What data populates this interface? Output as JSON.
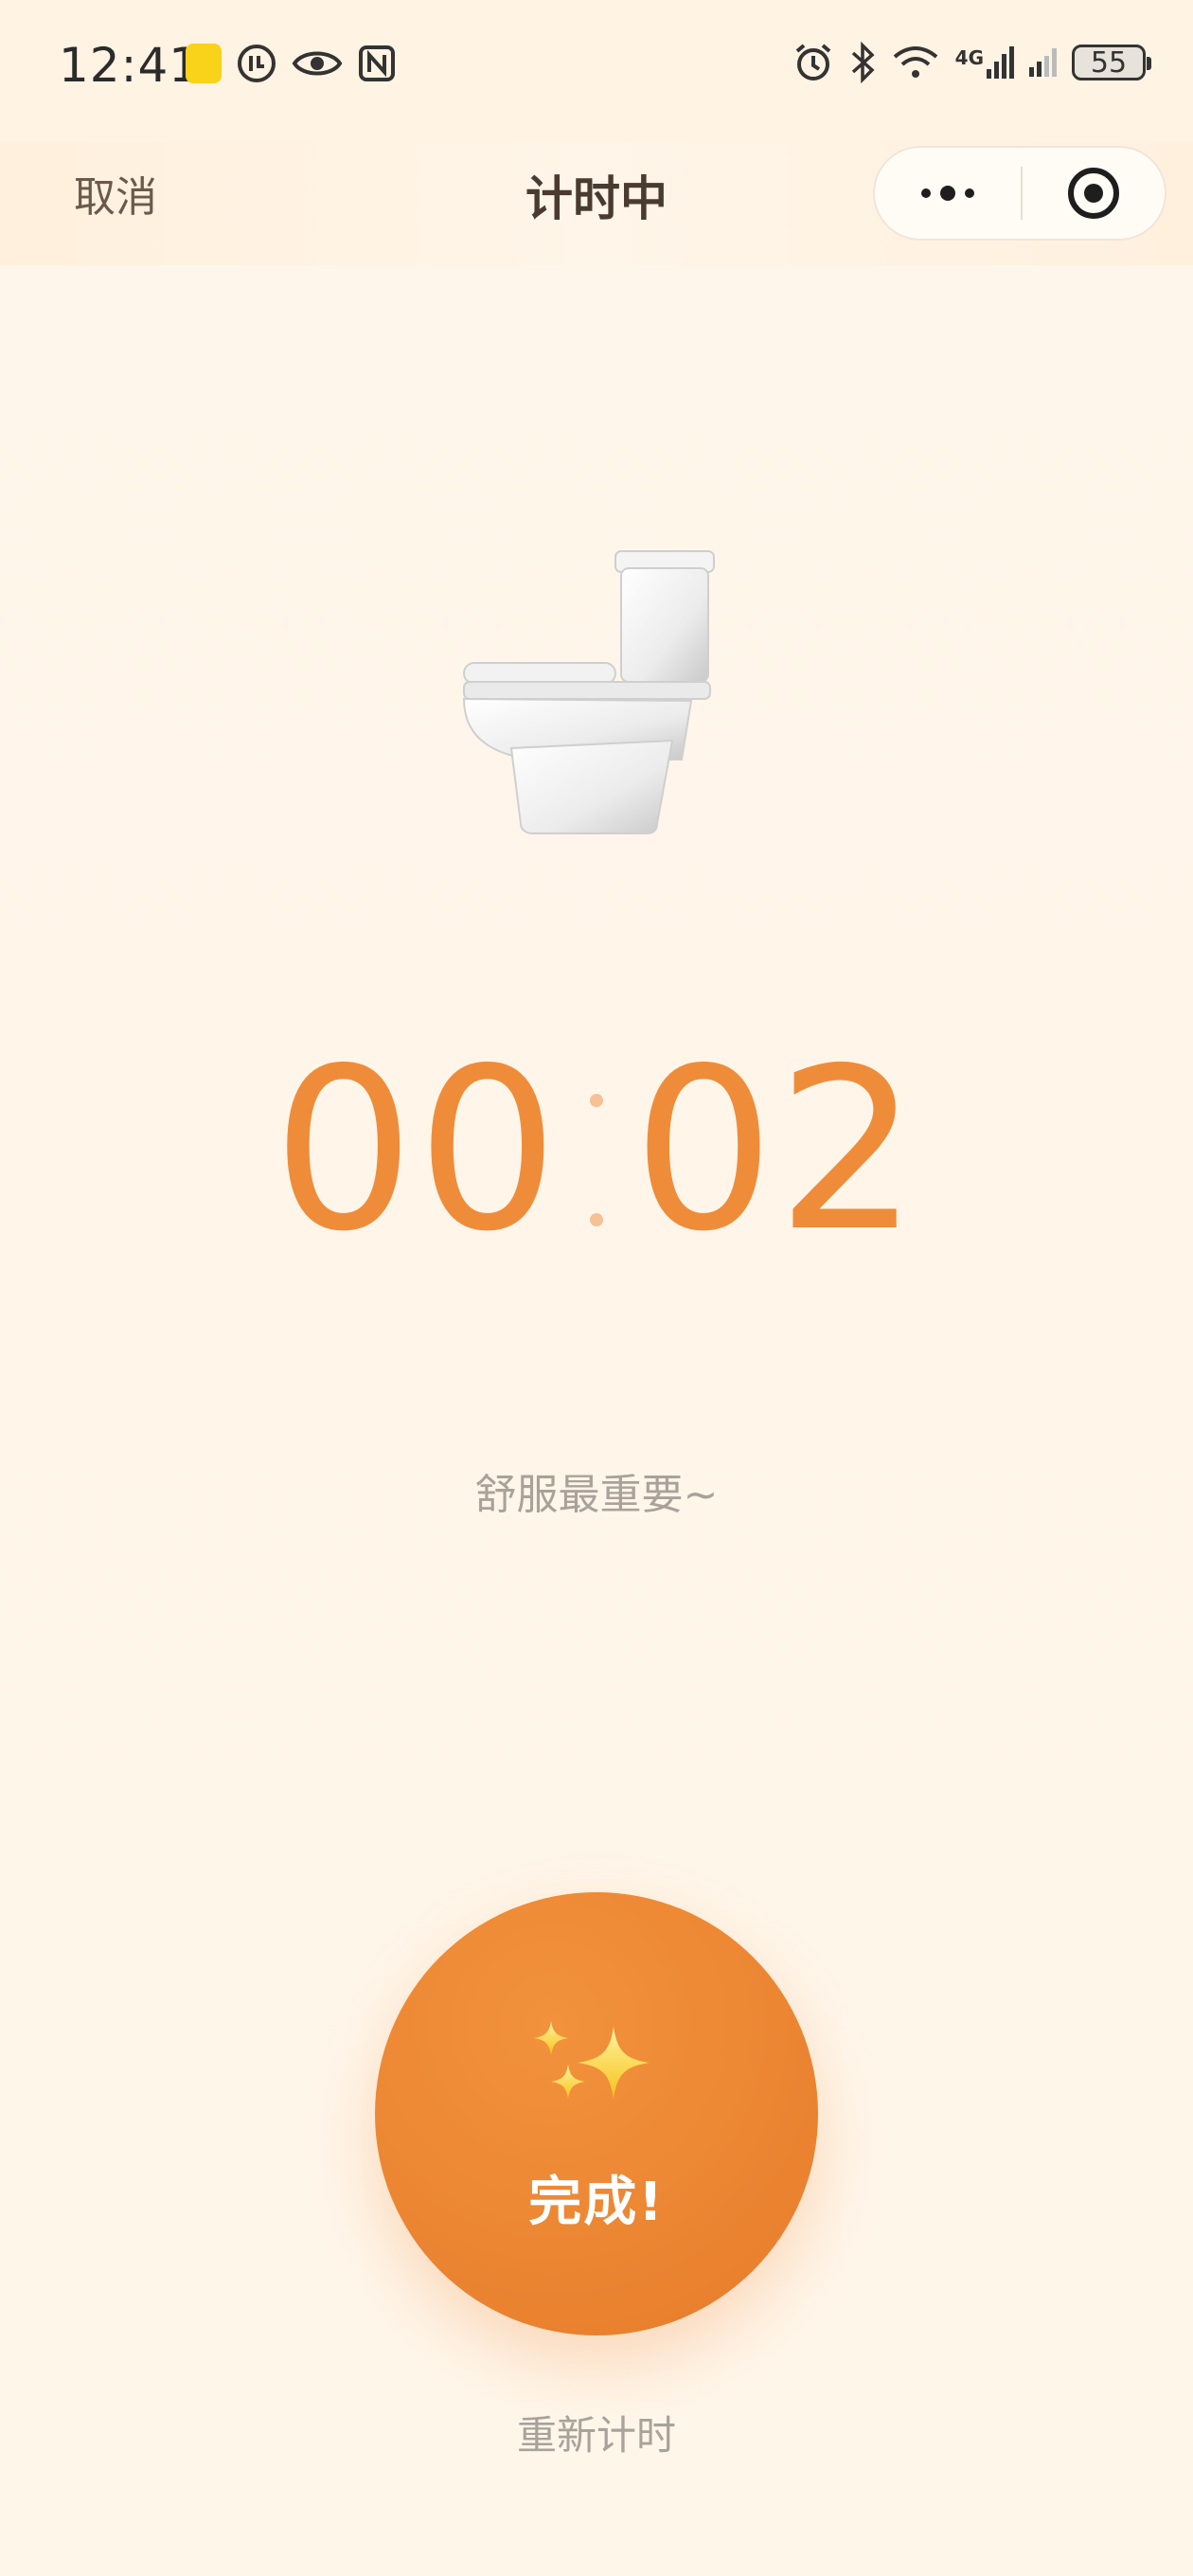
{
  "status_bar": {
    "time": "12:41",
    "battery": "55",
    "network": "4G",
    "left_icons": [
      "app-badge-icon",
      "clock-badge-icon",
      "eye-icon",
      "nfc-icon"
    ],
    "right_icons": [
      "alarm-icon",
      "bluetooth-icon",
      "wifi-icon",
      "cellular-4g-icon",
      "cellular-signal-icon",
      "battery-icon"
    ]
  },
  "nav": {
    "cancel_label": "取消",
    "title": "计时中",
    "capsule_icons": [
      "more-icon",
      "close-target-icon"
    ]
  },
  "main": {
    "illustration_icon": "toilet-icon",
    "timer": {
      "minutes": "00",
      "seconds": "02"
    },
    "hint": "舒服最重要~",
    "done_button": {
      "icon": "sparkles-icon",
      "label": "完成!"
    },
    "reset_label": "重新计时"
  },
  "colors": {
    "accent": "#ef8c3a",
    "button_bg": "#ec8633",
    "background": "#fff6ec",
    "muted_text": "#a9a29a",
    "title_text": "#4a3a30"
  }
}
